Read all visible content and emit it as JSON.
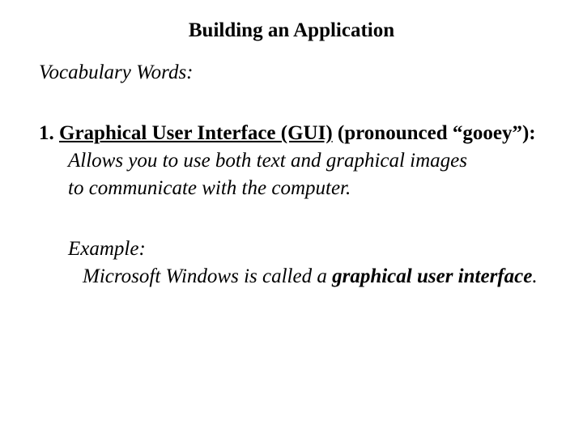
{
  "title": "Building an Application",
  "subheading": "Vocabulary Words:",
  "item": {
    "number": "1. ",
    "term_underlined": "Graphical User Interface (GUI)",
    "term_rest": " (pronounced “gooey”):",
    "definition_line1": "Allows you to use both text and graphical images",
    "definition_line2": "to communicate with the computer.",
    "example_label": "Example:",
    "example_prefix": " Microsoft Windows is called a ",
    "example_bold": "graphical user interface",
    "example_suffix": "."
  }
}
